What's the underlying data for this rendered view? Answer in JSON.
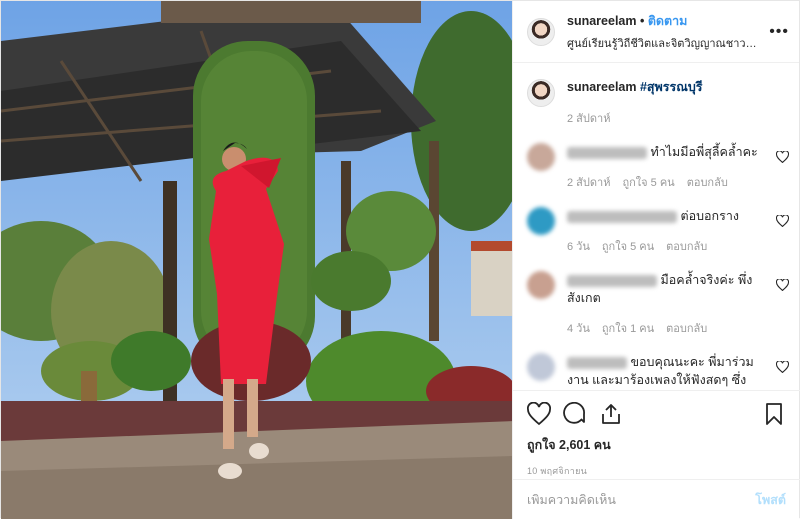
{
  "header": {
    "username": "sunareelam",
    "separator": " • ",
    "follow_label": "ติดตาม",
    "location": "ศูนย์เรียนรู้วิถีชีวิตและจิตวิญญาณชาวนาไทย - นาเ...",
    "more": "•••"
  },
  "caption": {
    "username": "sunareelam",
    "hashtag": "#สุพรรณบุรี",
    "time": "2 สัปดาห์"
  },
  "comments": [
    {
      "text": "ทำไมมีอพี่สุลี้คล้ำคะ",
      "time": "2 สัปดาห์",
      "likes": "ถูกใจ 5 คน",
      "reply": "ตอบกลับ"
    },
    {
      "text": "ต่อบอกราง",
      "time": "6 วัน",
      "likes": "ถูกใจ 5 คน",
      "reply": "ตอบกลับ"
    },
    {
      "text": "มือคล้ำจริงค่ะ พึ่งสังเกต",
      "time": "4 วัน",
      "likes": "ถูกใจ 1 คน",
      "reply": "ตอบกลับ"
    },
    {
      "text": "ขอบคุณนะคะ พี่มาร่วมงาน และมาร้องเพลงให้ฟังสดๆ ซึ่ง",
      "time": "",
      "likes": "",
      "reply": ""
    }
  ],
  "likes_text": "ถูกใจ 2,601 คน",
  "date_text": "10 พฤศจิกายน",
  "add_comment_placeholder": "เพิ่มความคิดเห็น",
  "post_label": "โพสต์",
  "colors": {
    "link": "#3897f0",
    "hashtag": "#003569",
    "muted": "#999999",
    "dress": "#e8203a"
  }
}
